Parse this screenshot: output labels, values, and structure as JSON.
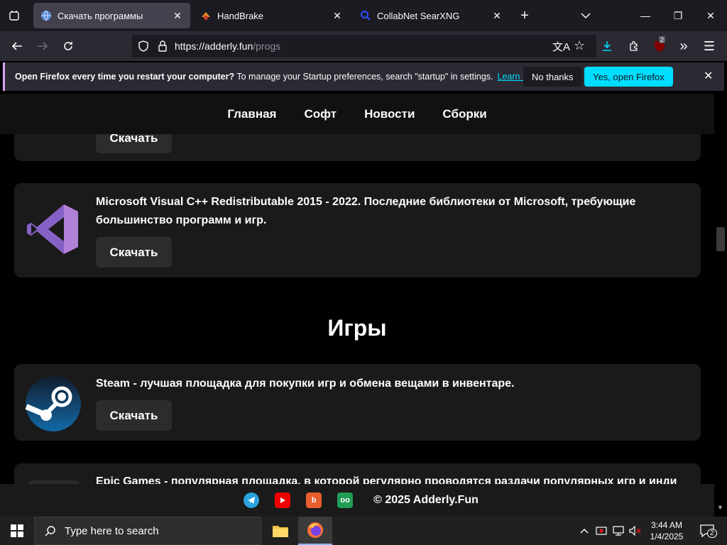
{
  "browser": {
    "tabs": [
      {
        "label": "Скачать программы",
        "active": true
      },
      {
        "label": "HandBrake",
        "active": false
      },
      {
        "label": "CollabNet SearXNG",
        "active": false
      }
    ],
    "url_host": "https://adderly.fun",
    "url_path": "/progs",
    "badge_count": "2"
  },
  "notification": {
    "bold": "Open Firefox every time you restart your computer?",
    "text": " To manage your Startup preferences, search \"startup\" in settings.",
    "learn_more": "Learn more",
    "no_thanks": "No thanks",
    "yes_open": "Yes, open Firefox"
  },
  "site_nav": [
    "Главная",
    "Софт",
    "Новости",
    "Сборки"
  ],
  "cards": [
    {
      "title": "",
      "download": "Скачать"
    },
    {
      "title": "Microsoft Visual C++ Redistributable 2015 - 2022. Последние библиотеки от Microsoft, требующие большинство программ и игр.",
      "download": "Скачать"
    },
    {
      "title": "Steam - лучшая площадка для покупки игр и обмена вещами в инвентаре.",
      "download": "Скачать"
    },
    {
      "title": "Epic Games - популярная площадка, в которой регулярно проводятся раздачи популярных игр и инди"
    }
  ],
  "section_heading": "Игры",
  "footer": {
    "copyright": "© 2025 Adderly.Fun"
  },
  "taskbar": {
    "search_placeholder": "Type here to search",
    "time": "3:44 AM",
    "date": "1/4/2025",
    "notifications": "2"
  },
  "colors": {
    "accent_cyan": "#00ddff",
    "vs_purple": "#8661c5",
    "steam_blue": "#1b2838"
  }
}
